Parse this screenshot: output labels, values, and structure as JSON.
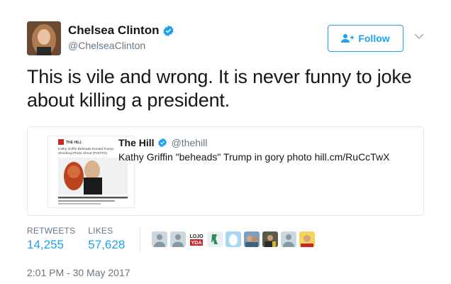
{
  "author": {
    "name": "Chelsea Clinton",
    "handle": "@ChelseaClinton",
    "verified_icon": "verified-badge-icon",
    "avatar_icon": "author-avatar"
  },
  "follow_button": {
    "label": "Follow",
    "icon": "add-user-icon"
  },
  "tweet": {
    "text": "This is vile and wrong. It is never funny to joke about killing a president."
  },
  "quoted_tweet": {
    "name": "The Hill",
    "handle": "@thehill",
    "text": "Kathy Griffin \"beheads\" Trump in gory photo hill.cm/RuCcTwX",
    "media": {
      "header": "THE HILL",
      "headline": "Kathy Griffin Beheads Donald Trump in Shocking Photo Shoot (PHOTO)",
      "caption": "Kathy Griffin Beheads Donald Trump in Shocking Photo Shoot"
    }
  },
  "stats": {
    "retweets_label": "RETWEETS",
    "retweets_value": "14,255",
    "likes_label": "LIKES",
    "likes_value": "57,628"
  },
  "likers": [
    {
      "icon": "default-avatar-icon"
    },
    {
      "icon": "default-avatar-icon"
    },
    {
      "icon": "lojo-yda-avatar",
      "text": "LOJO YDA"
    },
    {
      "icon": "green-figure-avatar"
    },
    {
      "icon": "egg-avatar-icon"
    },
    {
      "icon": "photo-avatar"
    },
    {
      "icon": "photo-avatar"
    },
    {
      "icon": "default-avatar-icon"
    },
    {
      "icon": "photo-avatar"
    }
  ],
  "timestamp": "2:01 PM - 30 May 2017",
  "colors": {
    "accent": "#1da1f2",
    "muted": "#657786",
    "text": "#14171a",
    "border": "#e1e8ed"
  }
}
